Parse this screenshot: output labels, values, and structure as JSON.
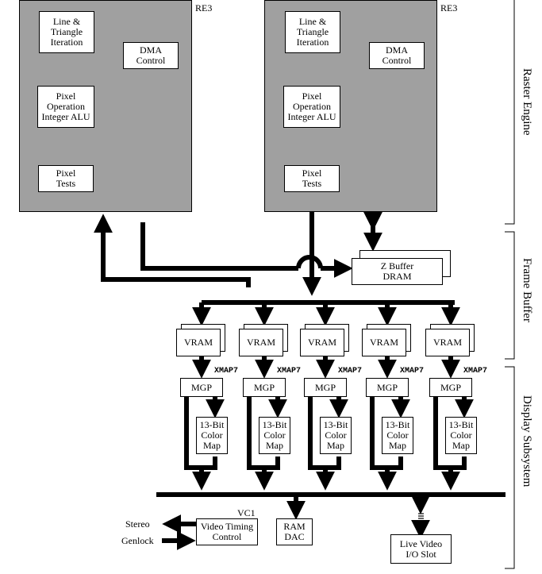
{
  "raster_engine": {
    "chips": [
      {
        "label": "RE3",
        "line_triangle": "Line &\nTriangle\nIteration",
        "dma": "DMA\nControl",
        "pixel_op": "Pixel\nOperation\nInteger ALU",
        "pixel_tests": "Pixel\nTests"
      },
      {
        "label": "RE3",
        "line_triangle": "Line &\nTriangle\nIteration",
        "dma": "DMA\nControl",
        "pixel_op": "Pixel\nOperation\nInteger ALU",
        "pixel_tests": "Pixel\nTests"
      }
    ]
  },
  "frame_buffer": {
    "zbuffer": "Z Buffer\nDRAM",
    "vram": [
      "VRAM",
      "VRAM",
      "VRAM",
      "VRAM",
      "VRAM"
    ]
  },
  "display": {
    "xmap_label": "XMAP7",
    "channels": [
      {
        "mgp": "MGP",
        "colormap": "13-Bit\nColor\nMap"
      },
      {
        "mgp": "MGP",
        "colormap": "13-Bit\nColor\nMap"
      },
      {
        "mgp": "MGP",
        "colormap": "13-Bit\nColor\nMap"
      },
      {
        "mgp": "MGP",
        "colormap": "13-Bit\nColor\nMap"
      },
      {
        "mgp": "MGP",
        "colormap": "13-Bit\nColor\nMap"
      }
    ],
    "vc1_label": "VC1",
    "video_timing": "Video Timing\nControl",
    "ramdac": "RAM\nDAC",
    "live_video": "Live Video\nI/O Slot",
    "stereo": "Stereo",
    "genlock": "Genlock"
  },
  "sections": {
    "raster_engine": "Raster Engine",
    "frame_buffer": "Frame Buffer",
    "display_subsystem": "Display Subsystem"
  },
  "colors": {
    "chip_fill": "#a0a0a0",
    "line": "#000000",
    "background": "#ffffff"
  }
}
